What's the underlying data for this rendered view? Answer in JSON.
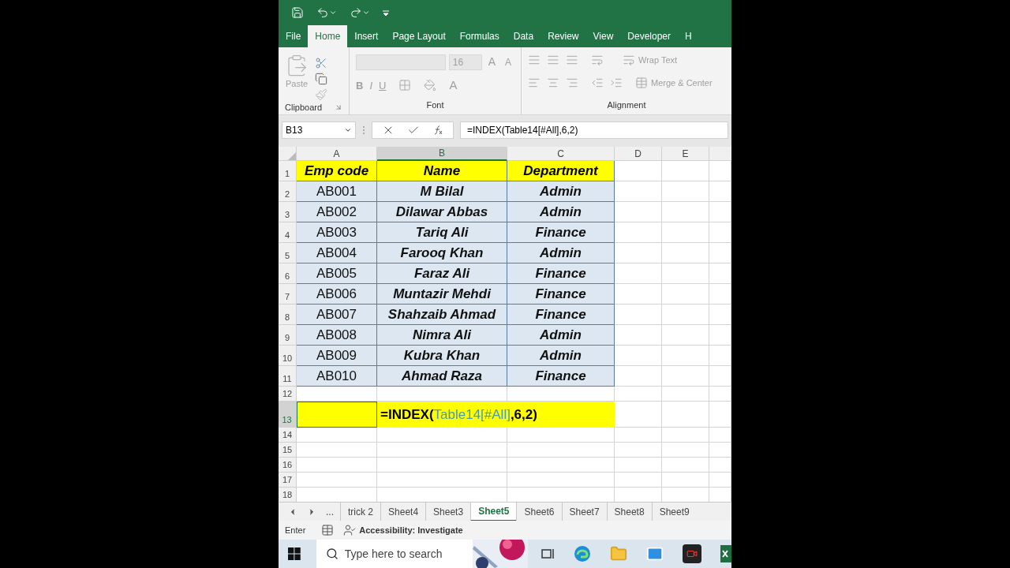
{
  "ribbon_tabs": [
    {
      "label": "File",
      "selected": false
    },
    {
      "label": "Home",
      "selected": true
    },
    {
      "label": "Insert",
      "selected": false
    },
    {
      "label": "Page Layout",
      "selected": false
    },
    {
      "label": "Formulas",
      "selected": false
    },
    {
      "label": "Data",
      "selected": false
    },
    {
      "label": "Review",
      "selected": false
    },
    {
      "label": "View",
      "selected": false
    },
    {
      "label": "Developer",
      "selected": false
    },
    {
      "label": "H",
      "selected": false
    }
  ],
  "clipboard": {
    "paste": "Paste",
    "group": "Clipboard"
  },
  "font": {
    "size": "16",
    "grow": "A",
    "shrink": "A",
    "styles": [
      "B",
      "I",
      "U"
    ],
    "color_button": "A",
    "group": "Font"
  },
  "alignment": {
    "wrap": "Wrap Text",
    "merge": "Merge & Center",
    "group": "Alignment"
  },
  "formula_bar": {
    "name_box": "B13",
    "formula": "=INDEX(Table14[#All],6,2)"
  },
  "columns": [
    {
      "label": "A",
      "selected": false
    },
    {
      "label": "B",
      "selected": true
    },
    {
      "label": "C",
      "selected": false
    },
    {
      "label": "D",
      "selected": false
    },
    {
      "label": "E",
      "selected": false
    }
  ],
  "rows": [
    {
      "number": "1",
      "selected": false,
      "kind": "header",
      "cells": [
        "Emp code",
        "Name",
        "Department"
      ]
    },
    {
      "number": "2",
      "selected": false,
      "kind": "data",
      "cells": [
        "AB001",
        "M Bilal",
        "Admin"
      ]
    },
    {
      "number": "3",
      "selected": false,
      "kind": "data",
      "cells": [
        "AB002",
        "Dilawar Abbas",
        "Admin"
      ]
    },
    {
      "number": "4",
      "selected": false,
      "kind": "data",
      "cells": [
        "AB003",
        "Tariq Ali",
        "Finance"
      ]
    },
    {
      "number": "5",
      "selected": false,
      "kind": "data",
      "cells": [
        "AB004",
        "Farooq Khan",
        "Admin"
      ]
    },
    {
      "number": "6",
      "selected": false,
      "kind": "data",
      "cells": [
        "AB005",
        "Faraz Ali",
        "Finance"
      ]
    },
    {
      "number": "7",
      "selected": false,
      "kind": "data",
      "cells": [
        "AB006",
        "Muntazir Mehdi",
        "Finance"
      ]
    },
    {
      "number": "8",
      "selected": false,
      "kind": "data",
      "cells": [
        "AB007",
        "Shahzaib Ahmad",
        "Finance"
      ]
    },
    {
      "number": "9",
      "selected": false,
      "kind": "data",
      "cells": [
        "AB008",
        "Nimra Ali",
        "Admin"
      ]
    },
    {
      "number": "10",
      "selected": false,
      "kind": "data",
      "cells": [
        "AB009",
        "Kubra Khan",
        "Admin"
      ]
    },
    {
      "number": "11",
      "selected": false,
      "kind": "data",
      "cells": [
        "AB010",
        "Ahmad Raza",
        "Finance"
      ]
    },
    {
      "number": "12",
      "selected": false,
      "kind": "empty"
    },
    {
      "number": "13",
      "selected": true,
      "kind": "highlight",
      "formula": [
        {
          "text": "=INDEX(",
          "kind": "plain"
        },
        {
          "text": "Table14[#All]",
          "kind": "reference"
        },
        {
          "text": ",6,2)",
          "kind": "plain"
        }
      ]
    },
    {
      "number": "14",
      "selected": false,
      "kind": "empty"
    },
    {
      "number": "15",
      "selected": false,
      "kind": "empty"
    },
    {
      "number": "16",
      "selected": false,
      "kind": "empty"
    },
    {
      "number": "17",
      "selected": false,
      "kind": "empty"
    },
    {
      "number": "18",
      "selected": false,
      "kind": "empty"
    }
  ],
  "sheet_tabs": {
    "overflow": "...",
    "tabs": [
      {
        "label": "trick 2",
        "selected": false
      },
      {
        "label": "Sheet4",
        "selected": false
      },
      {
        "label": "Sheet3",
        "selected": false
      },
      {
        "label": "Sheet5",
        "selected": true
      },
      {
        "label": "Sheet6",
        "selected": false
      },
      {
        "label": "Sheet7",
        "selected": false
      },
      {
        "label": "Sheet8",
        "selected": false
      },
      {
        "label": "Sheet9",
        "selected": false
      }
    ]
  },
  "status_bar": {
    "mode": "Enter",
    "accessibility": "Accessibility: Investigate"
  },
  "taskbar": {
    "search_placeholder": "Type here to search"
  }
}
